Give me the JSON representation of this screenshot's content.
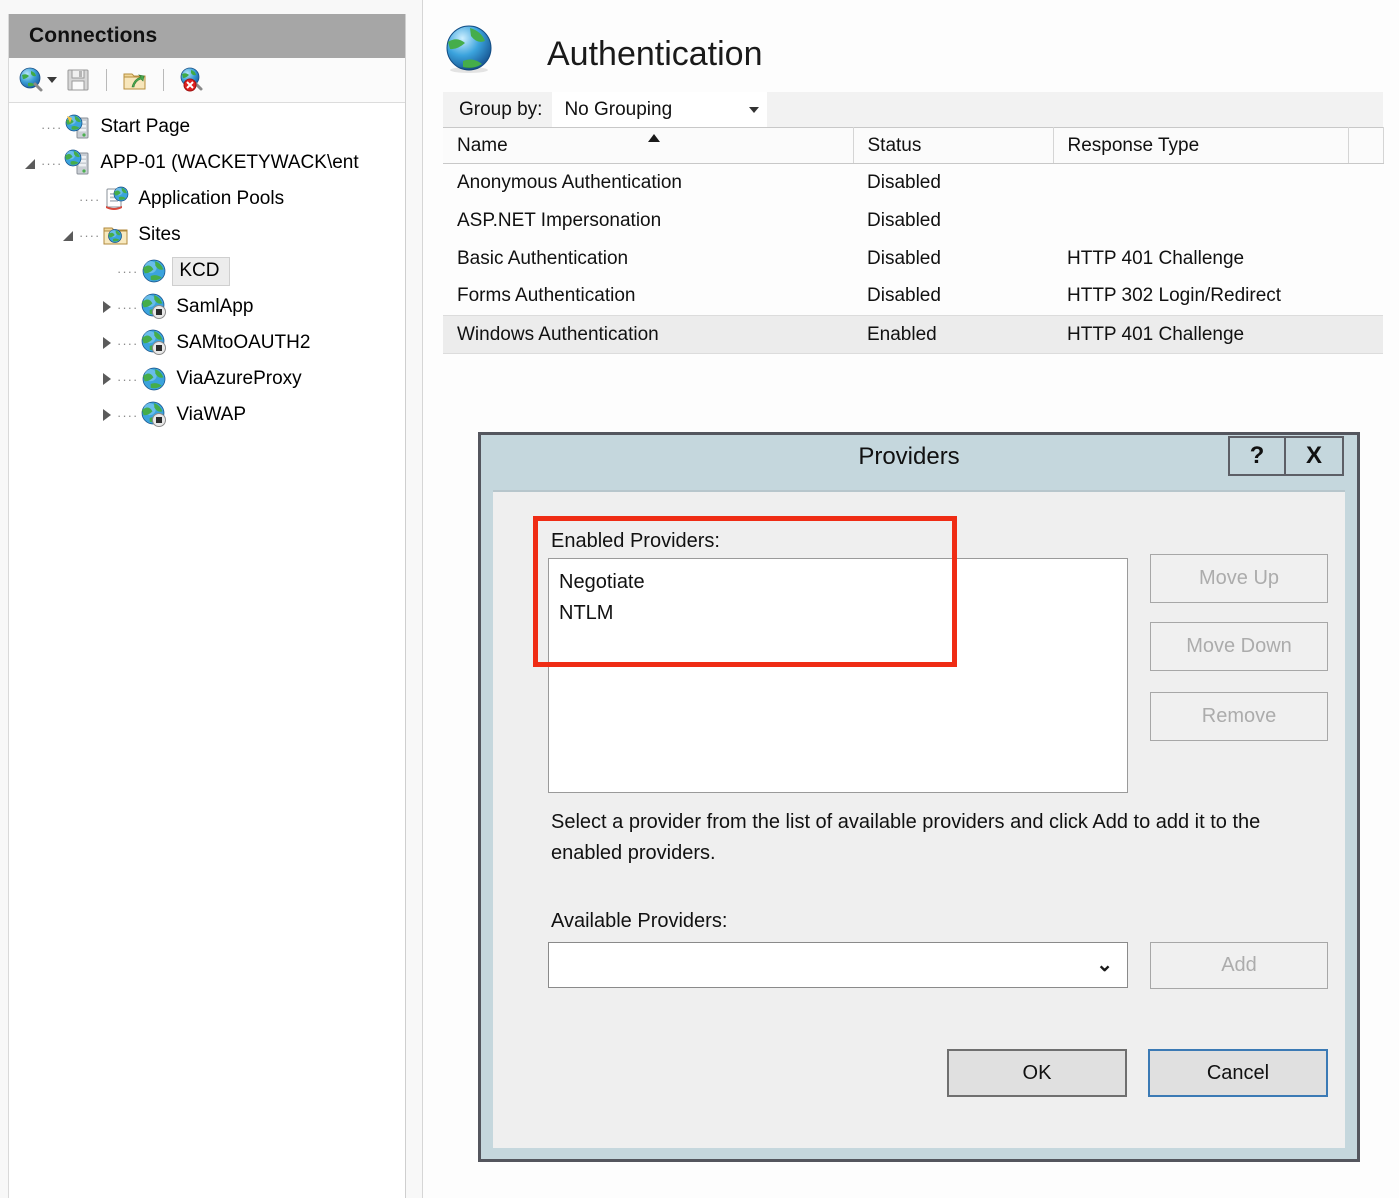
{
  "connections": {
    "header_title": "Connections",
    "toolbar": [
      {
        "name": "connect-to-icon",
        "label": "Connect To"
      },
      {
        "name": "save-connections-icon",
        "label": "Save Connections"
      },
      {
        "name": "connect-to-site-icon",
        "label": "Connect to a Site"
      },
      {
        "name": "disconnect-icon",
        "label": "Disconnect"
      }
    ],
    "tree": [
      {
        "label": "Start Page",
        "icon": "start-page-icon",
        "indent": 0,
        "expander": "none",
        "selected": false
      },
      {
        "label": "APP-01 (WACKETYWACK\\ent",
        "icon": "server-icon",
        "indent": 0,
        "expander": "expanded",
        "selected": false
      },
      {
        "label": "Application Pools",
        "icon": "application-pools-icon",
        "indent": 1,
        "expander": "none",
        "selected": false
      },
      {
        "label": "Sites",
        "icon": "sites-folder-icon",
        "indent": 1,
        "expander": "expanded",
        "selected": false
      },
      {
        "label": "KCD",
        "icon": "site-icon",
        "indent": 2,
        "expander": "none",
        "selected": true
      },
      {
        "label": "SamlApp",
        "icon": "application-icon",
        "indent": 2,
        "expander": "collapsed",
        "selected": false
      },
      {
        "label": "SAMtoOAUTH2",
        "icon": "application-icon",
        "indent": 2,
        "expander": "collapsed",
        "selected": false
      },
      {
        "label": "ViaAzureProxy",
        "icon": "site-icon",
        "indent": 2,
        "expander": "collapsed",
        "selected": false
      },
      {
        "label": "ViaWAP",
        "icon": "application-icon",
        "indent": 2,
        "expander": "collapsed",
        "selected": false
      }
    ]
  },
  "main": {
    "page_title": "Authentication",
    "page_icon": "globe-icon",
    "group_by_label": "Group by:",
    "group_by_value": "No Grouping",
    "table": {
      "columns": [
        "Name",
        "Status",
        "Response Type"
      ],
      "sorted_column": "Name",
      "sort_direction": "ascending",
      "rows": [
        {
          "name": "Anonymous Authentication",
          "status": "Disabled",
          "response": "",
          "selected": false
        },
        {
          "name": "ASP.NET Impersonation",
          "status": "Disabled",
          "response": "",
          "selected": false
        },
        {
          "name": "Basic Authentication",
          "status": "Disabled",
          "response": "HTTP 401 Challenge",
          "selected": false
        },
        {
          "name": "Forms Authentication",
          "status": "Disabled",
          "response": "HTTP 302 Login/Redirect",
          "selected": false
        },
        {
          "name": "Windows Authentication",
          "status": "Enabled",
          "response": "HTTP 401 Challenge",
          "selected": true
        }
      ]
    }
  },
  "dialog": {
    "title": "Providers",
    "help_button": "?",
    "close_button": "X",
    "enabled_label": "Enabled Providers:",
    "enabled_providers": [
      "Negotiate",
      "NTLM"
    ],
    "move_up_label": "Move Up",
    "move_down_label": "Move Down",
    "remove_label": "Remove",
    "hint": "Select a provider from the list of available providers and click Add to add it to the enabled providers.",
    "available_label": "Available Providers:",
    "available_value": "",
    "add_label": "Add",
    "ok_label": "OK",
    "cancel_label": "Cancel"
  },
  "annotation": {
    "highlight_color": "#ef2c14",
    "target": "enabled-providers-list"
  }
}
